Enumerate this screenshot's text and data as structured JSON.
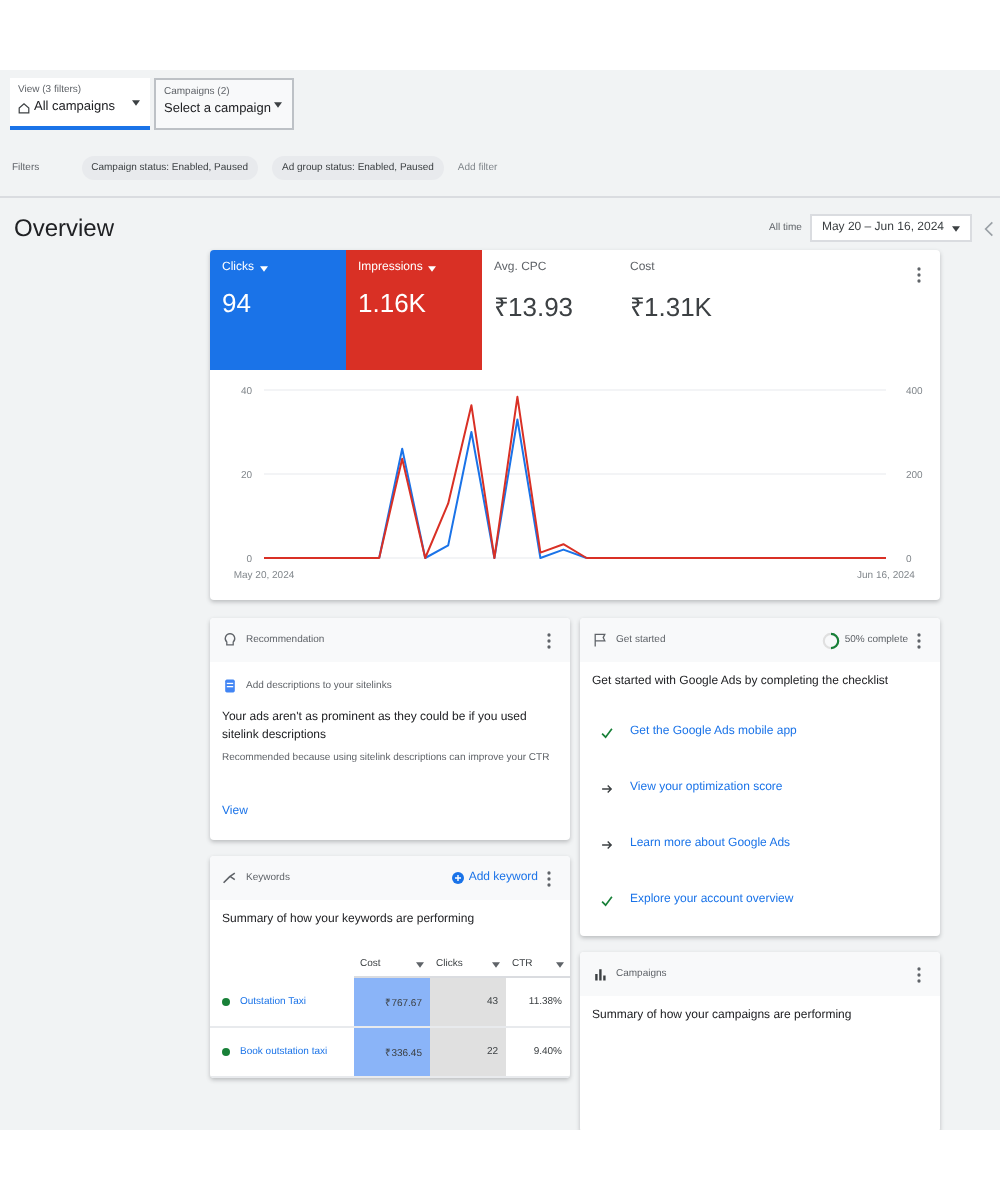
{
  "dropdowns": [
    {
      "label": "View (3 filters)",
      "value": "All campaigns",
      "selected": true
    },
    {
      "label": "Campaigns (2)",
      "value": "Select a campaign",
      "selected": false
    }
  ],
  "filters": {
    "label": "Filters",
    "chips": [
      "Campaign status: Enabled, Paused",
      "Ad group status: Enabled, Paused"
    ],
    "add_filter": "Add filter"
  },
  "overview": {
    "title": "Overview",
    "range_label": "All time",
    "date_range": "May 20 – Jun 16, 2024"
  },
  "metrics": [
    {
      "label": "Clicks",
      "value": "94",
      "selected": true,
      "color": "#1a73e8"
    },
    {
      "label": "Impressions",
      "value": "1.16K",
      "selected": true,
      "color": "#d93025"
    },
    {
      "label": "Avg. CPC",
      "value": "₹13.93",
      "selected": false,
      "color": "#5f6368"
    },
    {
      "label": "Cost",
      "value": "₹1.31K",
      "selected": false,
      "color": "#5f6368"
    }
  ],
  "chart_data": {
    "type": "line",
    "categories": [
      "May 20, 2024",
      null,
      null,
      null,
      null,
      null,
      null,
      null,
      null,
      null,
      null,
      null,
      null,
      null,
      null,
      null,
      null,
      null,
      null,
      null,
      null,
      null,
      null,
      null,
      null,
      null,
      null,
      "Jun 16, 2024"
    ],
    "ylim": [
      0,
      40
    ],
    "yticks": [
      0,
      20,
      40
    ],
    "y2lim": [
      0,
      400
    ],
    "y2ticks": [
      0,
      200,
      400
    ],
    "series": [
      {
        "color": "#1a73e8",
        "values": [
          null,
          null,
          null,
          null,
          null,
          0,
          26,
          0,
          3,
          30,
          0,
          33,
          0,
          2,
          0,
          null,
          null,
          null,
          null,
          null,
          null,
          null,
          null,
          null,
          null,
          null,
          null,
          null
        ]
      },
      {
        "color": "#d93025",
        "axis": "y2",
        "values": [
          0,
          0,
          0,
          0,
          0,
          0,
          236,
          0,
          130,
          364,
          0,
          384,
          13,
          33,
          0,
          0,
          0,
          0,
          0,
          0,
          0,
          0,
          0,
          0,
          0,
          0,
          0,
          0
        ]
      }
    ]
  },
  "recommendation": {
    "title": "Recommendation",
    "item": "Add descriptions to your sitelinks",
    "text": "Your ads aren't as prominent as they could be if you used sitelink descriptions",
    "reason": "Recommended because using sitelink descriptions can improve your CTR",
    "link": "View"
  },
  "keywords": {
    "title": "Keywords",
    "add": "Add keyword",
    "summary": "Summary of how your keywords are performing",
    "columns": [
      "Cost",
      "Clicks",
      "CTR"
    ],
    "rows": [
      {
        "name": "Outstation Taxi",
        "color": "#188038",
        "cells": [
          "₹767.67",
          "43",
          "11.38%"
        ]
      },
      {
        "name": "Book outstation taxi",
        "color": "#188038",
        "cells": [
          "₹336.45",
          "22",
          "9.40%"
        ]
      }
    ]
  },
  "get_started": {
    "title": "Get started",
    "progress": {
      "level": 0.5,
      "text": "50% complete"
    },
    "heading": "Get started with Google Ads by completing the checklist",
    "items": [
      {
        "label": "Get the Google Ads mobile app",
        "done": true
      },
      {
        "label": "View your optimization score",
        "done": false
      },
      {
        "label": "Learn more about Google Ads",
        "done": false
      },
      {
        "label": "Explore your account overview",
        "done": true
      }
    ]
  },
  "campaigns": {
    "title": "Campaigns",
    "summary": "Summary of how your campaigns are performing"
  }
}
